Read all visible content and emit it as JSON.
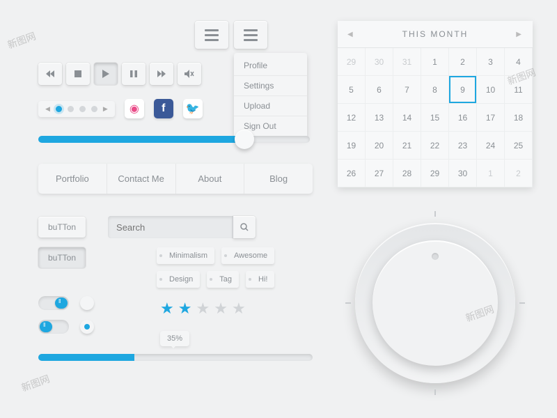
{
  "menu": {
    "items": [
      "Profile",
      "Settings",
      "Upload",
      "Sign Out"
    ]
  },
  "media_icons": [
    "rewind",
    "stop",
    "play",
    "pause",
    "forward",
    "mute"
  ],
  "pager": {
    "dots": 4,
    "active": 0
  },
  "social": [
    "dribbble",
    "facebook",
    "twitter"
  ],
  "slider": {
    "percent": 76
  },
  "tabs": [
    "Portfolio",
    "Contact Me",
    "About",
    "Blog"
  ],
  "buttons": {
    "normal": "buTTon",
    "pressed": "buTTon"
  },
  "search": {
    "placeholder": "Search"
  },
  "tags": [
    "Minimalism",
    "Awesome",
    "Design",
    "Tag",
    "Hi!"
  ],
  "toggles": [
    {
      "on": true
    },
    {
      "on": false
    }
  ],
  "radios": [
    false,
    true
  ],
  "tooltip": "35%",
  "rating": {
    "value": 2,
    "max": 5
  },
  "progress": {
    "percent": 35
  },
  "calendar": {
    "title": "THIS MONTH",
    "today": 9,
    "weeks": [
      [
        {
          "d": 29,
          "m": true
        },
        {
          "d": 30,
          "m": true
        },
        {
          "d": 31,
          "m": true
        },
        {
          "d": 1
        },
        {
          "d": 2
        },
        {
          "d": 3
        },
        {
          "d": 4
        }
      ],
      [
        {
          "d": 5
        },
        {
          "d": 6
        },
        {
          "d": 7
        },
        {
          "d": 8
        },
        {
          "d": 9,
          "t": true
        },
        {
          "d": 10
        },
        {
          "d": 11
        }
      ],
      [
        {
          "d": 12
        },
        {
          "d": 13
        },
        {
          "d": 14
        },
        {
          "d": 15
        },
        {
          "d": 16
        },
        {
          "d": 17
        },
        {
          "d": 18
        }
      ],
      [
        {
          "d": 19
        },
        {
          "d": 20
        },
        {
          "d": 21
        },
        {
          "d": 22
        },
        {
          "d": 23
        },
        {
          "d": 24
        },
        {
          "d": 25
        }
      ],
      [
        {
          "d": 26
        },
        {
          "d": 27
        },
        {
          "d": 28
        },
        {
          "d": 29
        },
        {
          "d": 30
        },
        {
          "d": 1,
          "m": true
        },
        {
          "d": 2,
          "m": true
        }
      ]
    ]
  },
  "watermark": "新图网"
}
